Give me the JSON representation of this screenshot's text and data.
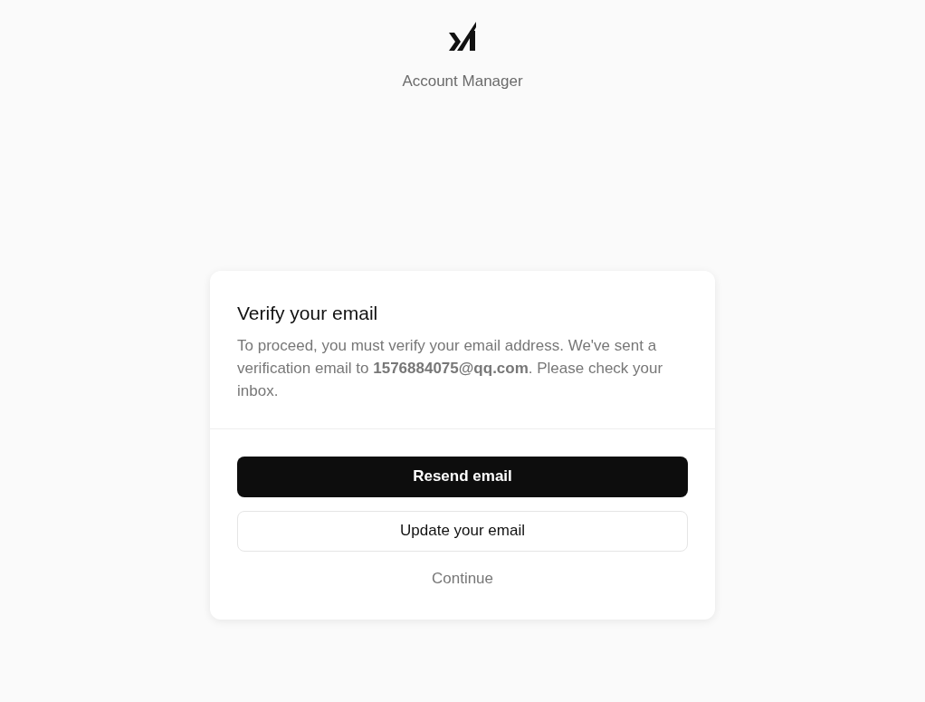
{
  "header": {
    "subtitle": "Account Manager"
  },
  "card": {
    "title": "Verify your email",
    "message": "To proceed, you must verify your email address. We've sent a verification email to **1576884075@qq.com**. Please check your inbox.",
    "buttons": [
      {
        "kind": "primary",
        "label": "Resend email"
      },
      {
        "kind": "secondary",
        "label": "Update your email"
      },
      {
        "kind": "link",
        "label": "Continue"
      }
    ]
  }
}
